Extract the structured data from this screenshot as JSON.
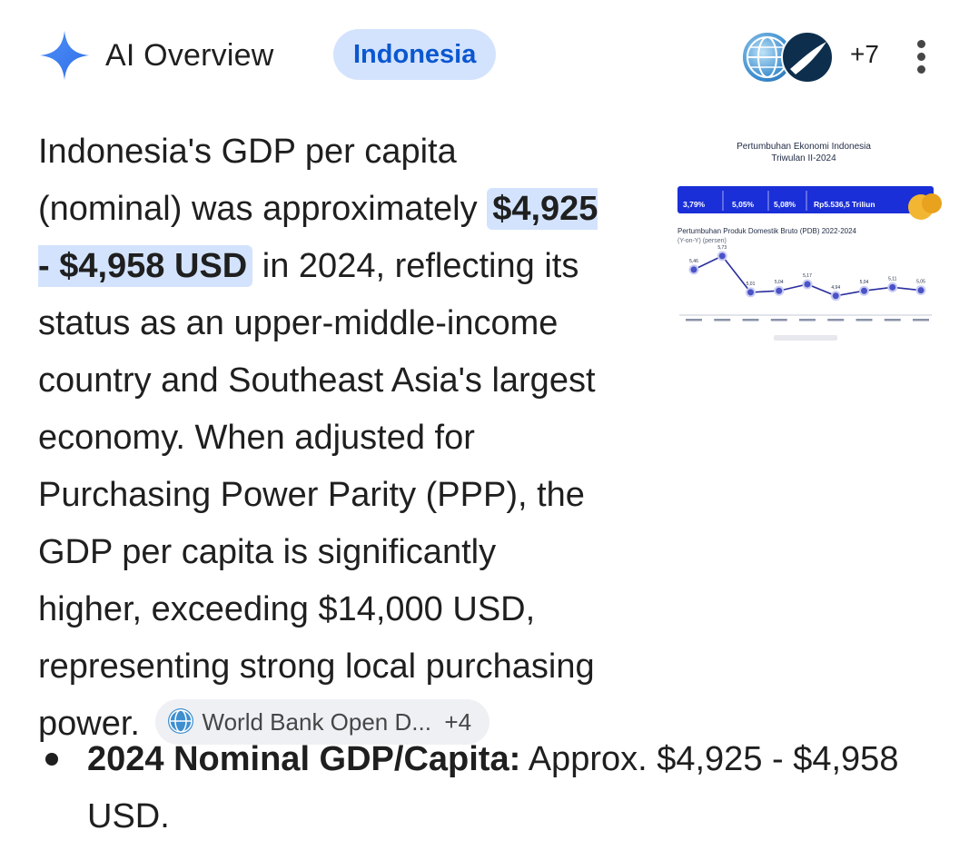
{
  "header": {
    "title": "AI Overview",
    "topic_chip": "Indonesia",
    "sources_more": "+7"
  },
  "icons": {
    "sparkle": "ai-sparkle-icon",
    "menu": "more-vert-icon",
    "source_avatar_1": "world-bank-globe-icon",
    "source_avatar_2": "brand-swoosh-icon"
  },
  "colors": {
    "accent": "#0b57d0",
    "chip_bg": "#d3e3fd",
    "sparkle": "#4285f4"
  },
  "overview": {
    "p1_before": "Indonesia's GDP per capita (nominal) was approximately ",
    "p1_highlight": "$4,925 - $4,958 USD",
    "p1_after": " in 2024, reflecting its status as an upper-middle-income country and Southeast Asia's largest economy. When adjusted for Purchasing Power Parity (PPP), the GDP per capita is significantly higher, exceeding $14,000 USD, representing strong local purchasing power.",
    "source_chip_label": "World Bank Open D...",
    "source_chip_more": "+4"
  },
  "thumbnail": {
    "title_line1": "Pertumbuhan Ekonomi Indonesia",
    "title_line2": "Triwulan II-2024",
    "stats": [
      "3,79%",
      "5,05%",
      "5,08%",
      "Rp5.536,5 Triliun"
    ],
    "chart_title": "Pertumbuhan Produk Domestik Bruto (PDB) 2022-2024",
    "chart_subtitle": "(Y-on-Y) (persen)",
    "point_labels": [
      "5,46",
      "5,73",
      "5,01",
      "5,04",
      "5,17",
      "4,94",
      "5,04",
      "5,11",
      "5,05"
    ],
    "point_values": [
      5.46,
      5.73,
      5.01,
      5.04,
      5.17,
      4.94,
      5.04,
      5.11,
      5.05
    ]
  },
  "bullets": [
    {
      "bold": "2024 Nominal GDP/Capita:",
      "text": " Approx. $4,925 - $4,958 USD."
    }
  ]
}
